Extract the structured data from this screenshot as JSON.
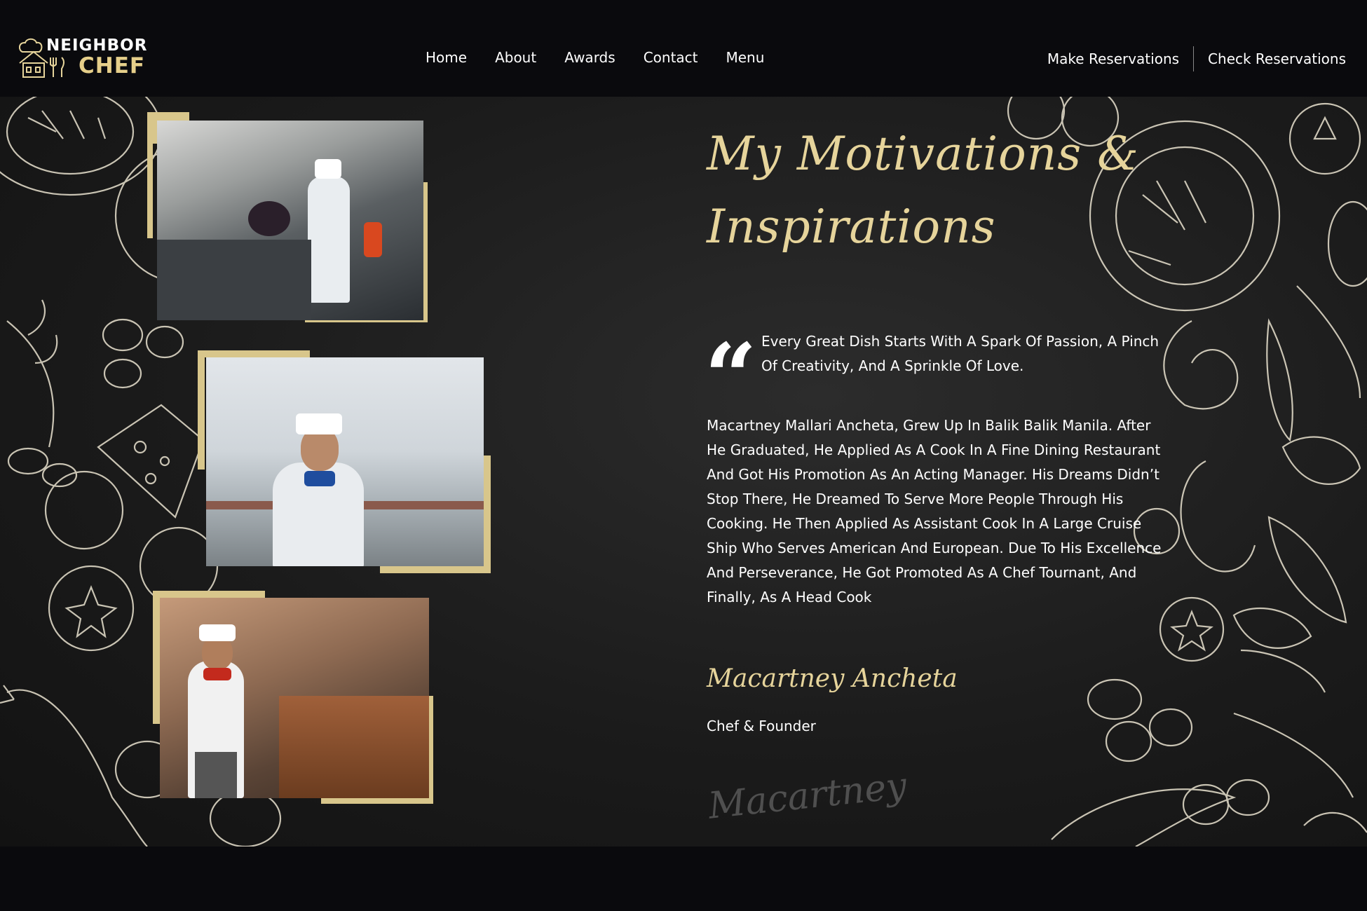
{
  "nav": {
    "logo_line1": "NEIGHBOR",
    "logo_line2": "CHEF",
    "items": [
      "Home",
      "About",
      "Awards",
      "Contact",
      "Menu"
    ],
    "make_reservations": "Make Reservations",
    "check_reservations": "Check Reservations"
  },
  "content": {
    "heading": "My Motivations & Inspirations",
    "quote": "Every Great Dish Starts With A Spark Of Passion, A Pinch Of Creativity, And A Sprinkle Of Love.",
    "bio": "Macartney Mallari Ancheta, Grew Up In Balik Balik Manila. After He Graduated, He Applied As A Cook In A Fine Dining Restaurant And Got His Promotion As An Acting Manager. His Dreams Didn’t Stop There, He Dreamed To Serve More People Through His Cooking. He Then Applied As Assistant Cook In A Large Cruise Ship Who Serves American And European. Due To His Excellence And Perseverance, He Got Promoted As A Chef Tournant, And Finally, As A Head Cook",
    "name": "Macartney Ancheta",
    "role": "Chef & Founder",
    "signature": "Macartney"
  },
  "colors": {
    "accent_gold": "#e6d49b",
    "frame_gold": "#d8c68b",
    "nav_bg": "#0a0a0d"
  },
  "icons": [
    "chef-hat-house-logo-icon",
    "quote-mark-icon"
  ]
}
